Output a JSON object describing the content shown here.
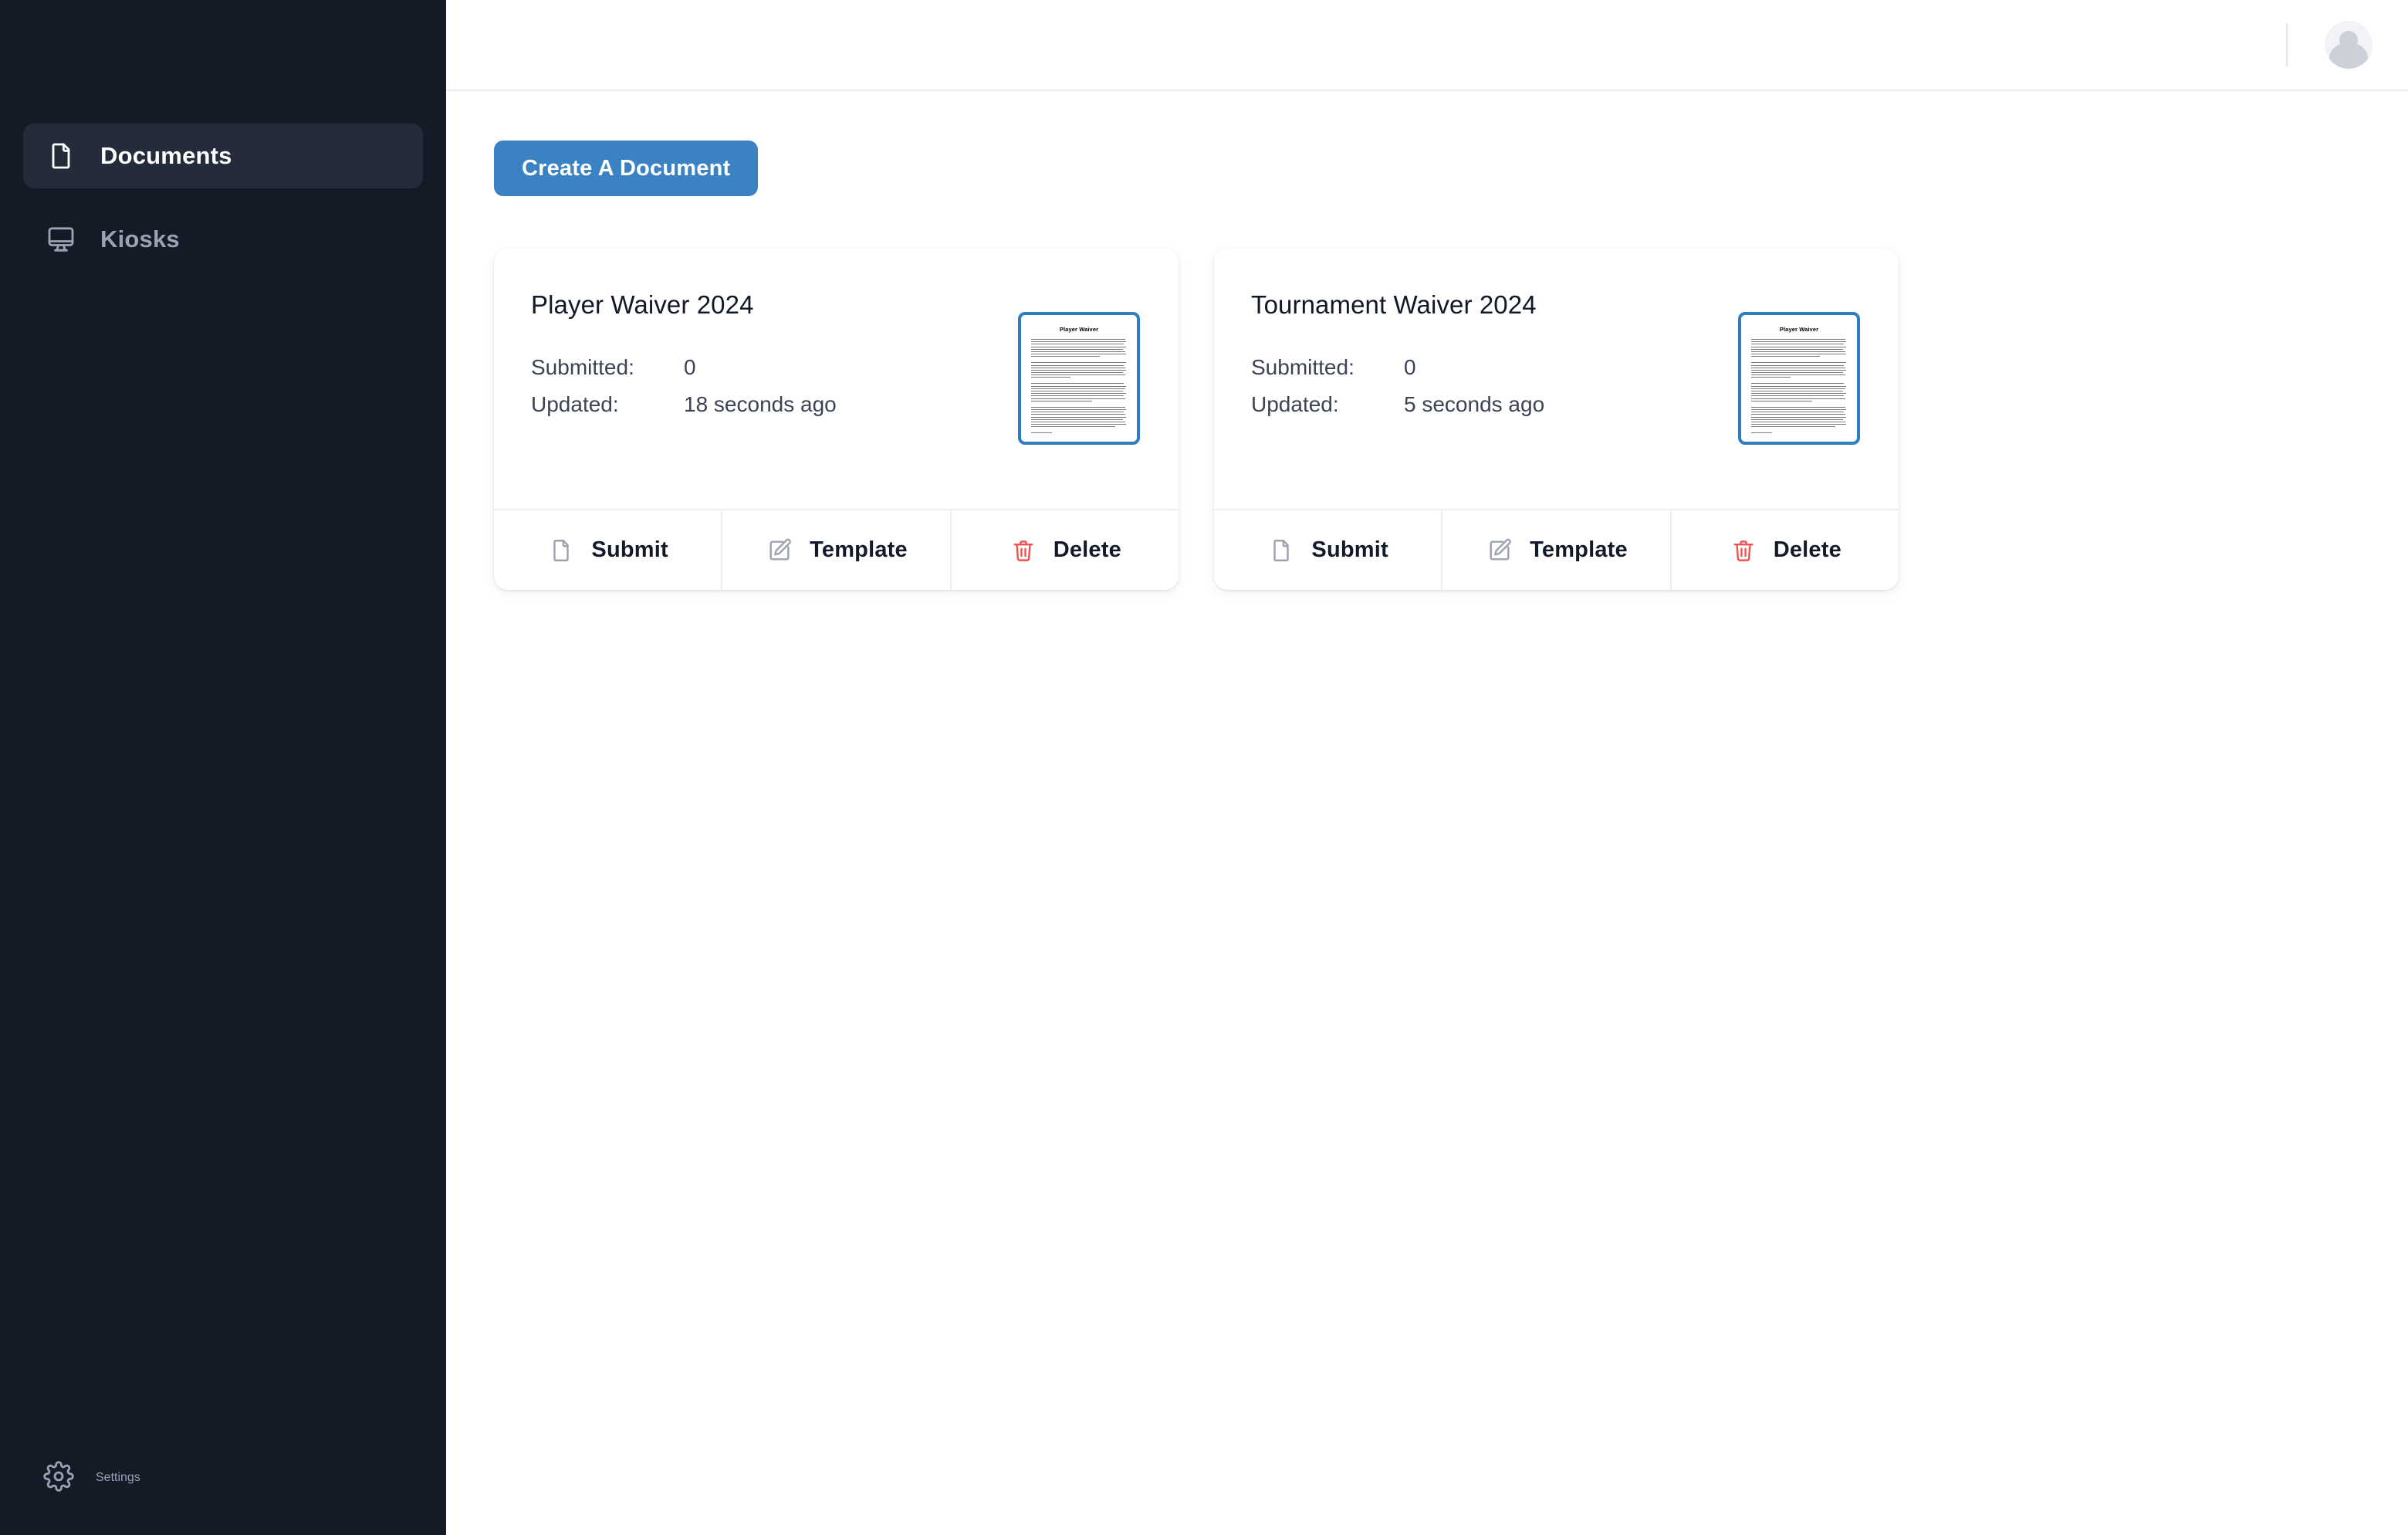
{
  "sidebar": {
    "items": [
      {
        "label": "Documents",
        "icon": "document-icon",
        "active": true
      },
      {
        "label": "Kiosks",
        "icon": "monitor-icon",
        "active": false
      }
    ],
    "settings": {
      "label": "Settings",
      "icon": "gear-icon"
    }
  },
  "topbar": {
    "avatar": "user-avatar"
  },
  "main": {
    "create_button": "Create A Document",
    "meta_labels": {
      "submitted": "Submitted:",
      "updated": "Updated:"
    },
    "footer_actions": {
      "submit": "Submit",
      "template": "Template",
      "delete": "Delete"
    },
    "documents": [
      {
        "title": "Player Waiver 2024",
        "submitted": "0",
        "updated": "18 seconds ago",
        "thumbnail_title": "Player Waiver"
      },
      {
        "title": "Tournament Waiver 2024",
        "submitted": "0",
        "updated": "5 seconds ago",
        "thumbnail_title": "Player Waiver"
      }
    ]
  },
  "colors": {
    "sidebar_bg": "#141a26",
    "sidebar_active_bg": "#242b3a",
    "accent_blue": "#3b82c4",
    "thumb_border": "#2f7ec1",
    "delete_red": "#ef5350",
    "icon_gray": "#9ca3af"
  }
}
